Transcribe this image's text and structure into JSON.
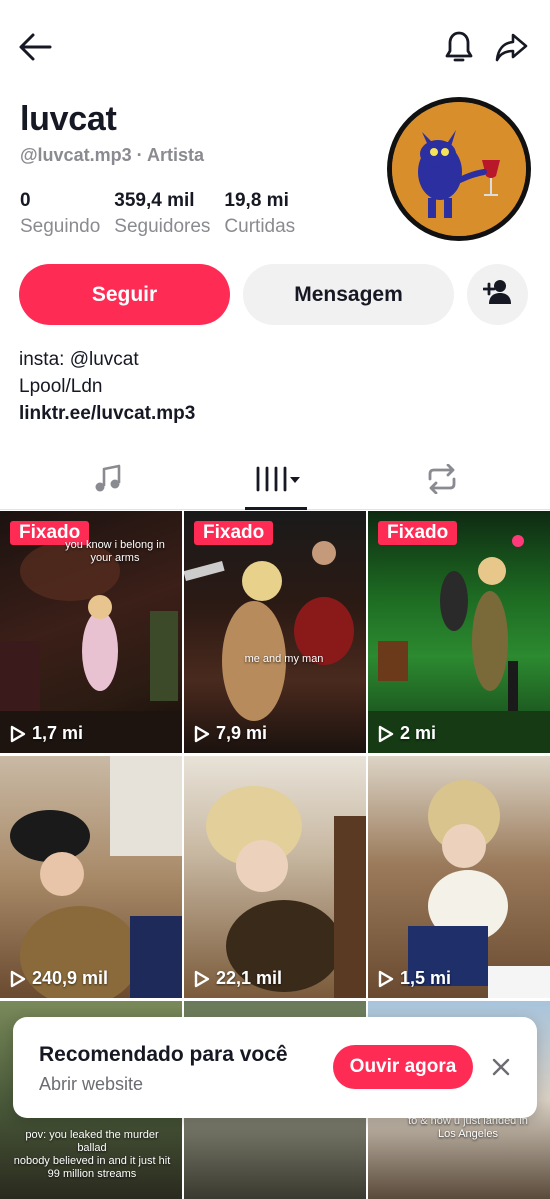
{
  "profile": {
    "name": "luvcat",
    "handle": "@luvcat.mp3",
    "separator": "·",
    "role": "Artista"
  },
  "stats": [
    {
      "value": "0",
      "label": "Seguindo"
    },
    {
      "value": "359,4 mil",
      "label": "Seguidores"
    },
    {
      "value": "19,8 mi",
      "label": "Curtidas"
    }
  ],
  "actions": {
    "follow_label": "Seguir",
    "message_label": "Mensagem",
    "add_friend_icon": "add-user-icon"
  },
  "bio": {
    "line1": "insta: @luvcat",
    "line2": "Lpool/Ldn",
    "link": "linktr.ee/luvcat.mp3"
  },
  "tabs": {
    "music_icon": "music-note-icon",
    "videos_icon": "grid-videos-icon",
    "repost_icon": "repost-icon",
    "active": "videos"
  },
  "videos": [
    {
      "pinned": "Fixado",
      "views": "1,7 mi",
      "caption": "you know i belong in\nyour arms"
    },
    {
      "pinned": "Fixado",
      "views": "7,9 mi",
      "caption": "me and my man"
    },
    {
      "pinned": "Fixado",
      "views": "2 mi",
      "caption": ""
    },
    {
      "pinned": "",
      "views": "240,9 mil",
      "caption": ""
    },
    {
      "pinned": "",
      "views": "22,1 mil",
      "caption": ""
    },
    {
      "pinned": "",
      "views": "1,5 mi",
      "caption": ""
    },
    {
      "pinned": "",
      "views": "",
      "caption": "pov: you leaked the murder ballad\nnobody believed in and it just hit\n99 million streams"
    },
    {
      "pinned": "",
      "views": "",
      "caption": ""
    },
    {
      "pinned": "",
      "views": "",
      "caption": "to & now u just landed in\nLos Angeles"
    }
  ],
  "banner": {
    "title": "Recomendado para você",
    "subtitle": "Abrir website",
    "cta": "Ouvir agora"
  },
  "colors": {
    "accent": "#fe2c55",
    "text": "#161823",
    "muted": "#8a8b91",
    "button_bg": "#f1f1f2"
  }
}
